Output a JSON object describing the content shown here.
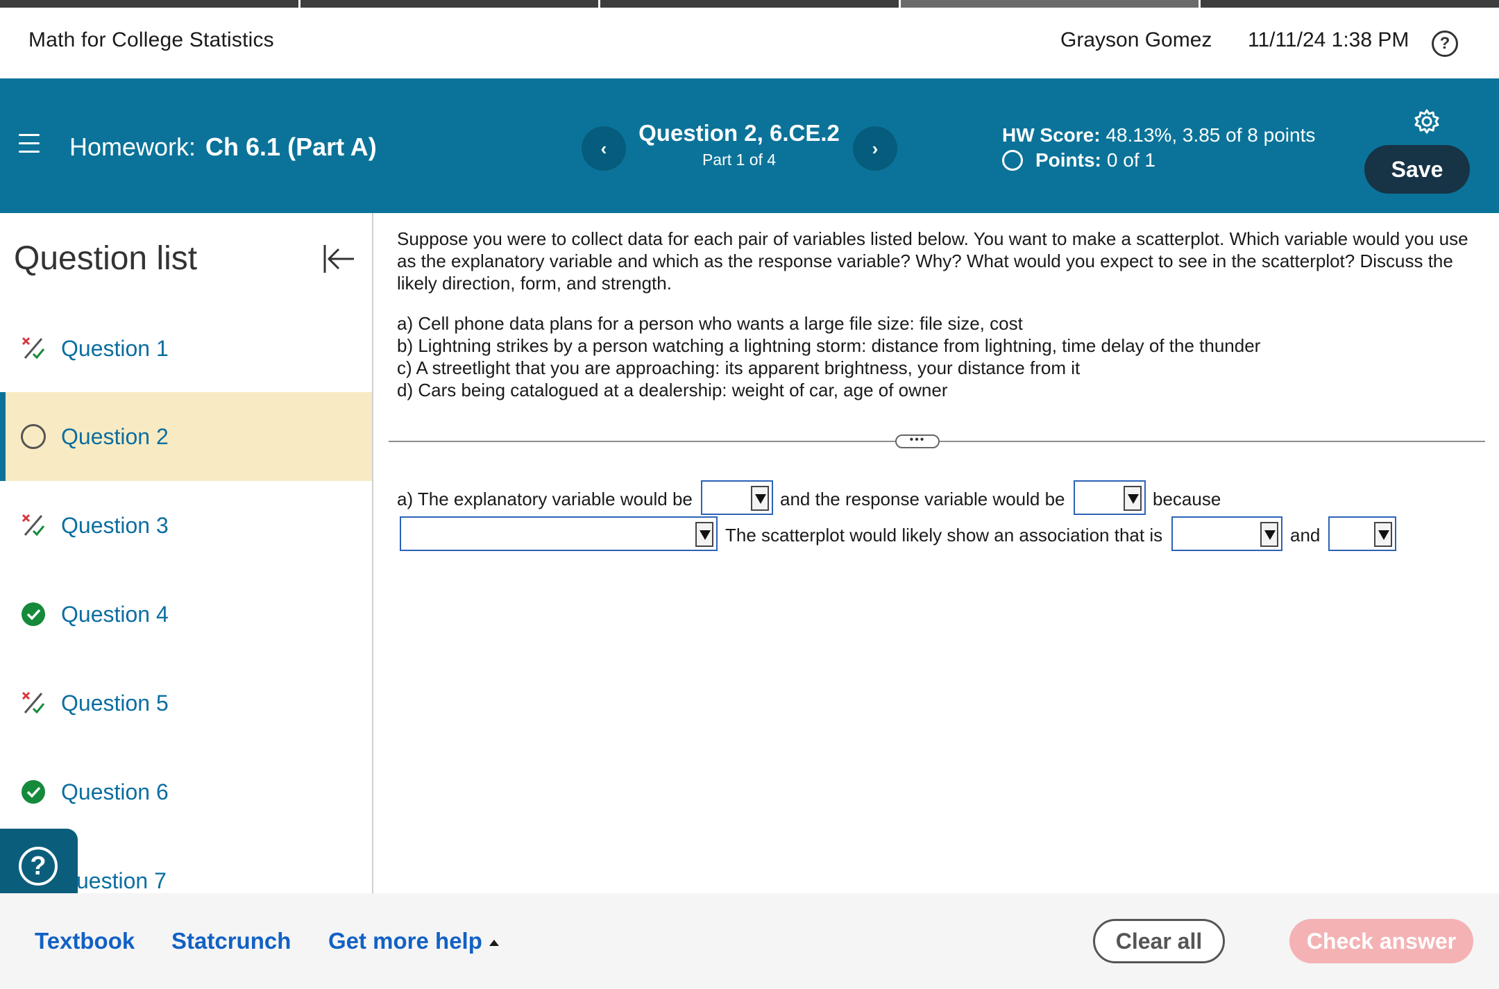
{
  "header": {
    "app_title": "Math for College Statistics",
    "user_name": "Grayson Gomez",
    "timestamp": "11/11/24 1:38 PM",
    "help_label": "?"
  },
  "homework": {
    "prefix": "Homework:",
    "name": "Ch 6.1 (Part A)",
    "question_title": "Question 2, 6.CE.2",
    "question_part": "Part 1 of 4",
    "prev_icon": "‹",
    "next_icon": "›",
    "hw_score_label": "HW Score:",
    "hw_score_value": "48.13%, 3.85 of 8 points",
    "points_label": "Points:",
    "points_value": "0 of 1",
    "save_label": "Save"
  },
  "sidebar": {
    "title": "Question list",
    "items": [
      {
        "label": "Question 1",
        "status": "partial"
      },
      {
        "label": "Question 2",
        "status": "current"
      },
      {
        "label": "Question 3",
        "status": "partial"
      },
      {
        "label": "Question 4",
        "status": "correct"
      },
      {
        "label": "Question 5",
        "status": "partial"
      },
      {
        "label": "Question 6",
        "status": "correct"
      },
      {
        "label": "uestion 7",
        "status": "hidden"
      }
    ],
    "help_float_label": "?"
  },
  "question": {
    "prompt": "Suppose you were to collect data for each pair of variables listed below. You want to make a scatterplot. Which variable would you use as the explanatory variable and which as the response variable? Why? What would you expect to see in the scatterplot? Discuss the likely direction, form, and strength.",
    "parts": [
      "a) Cell phone data plans for a person who wants a large file size: file size, cost",
      "b) Lightning strikes by a person watching a lightning storm: distance from lightning, time delay of the thunder",
      "c) A streetlight that you are approaching: its apparent brightness, your distance from it",
      "d) Cars being catalogued at a dealership: weight of car, age of owner"
    ],
    "divider_handle": "•••",
    "answer": {
      "text_1": "a) The explanatory variable would be",
      "text_2": "and the response variable would be",
      "text_3": "because",
      "text_4": "The scatterplot would likely show an association that is",
      "text_5": "and"
    }
  },
  "footer": {
    "textbook": "Textbook",
    "statcrunch": "Statcrunch",
    "more_help": "Get more help",
    "clear_all": "Clear all",
    "check_answer": "Check answer"
  },
  "colors": {
    "band": "#0b7399",
    "save": "#173346",
    "current_item": "#f8ebc3",
    "link": "#1261c4",
    "check_answer_disabled": "#f4b2b4",
    "correct": "#148a3a",
    "partial_x": "#d9363e"
  }
}
